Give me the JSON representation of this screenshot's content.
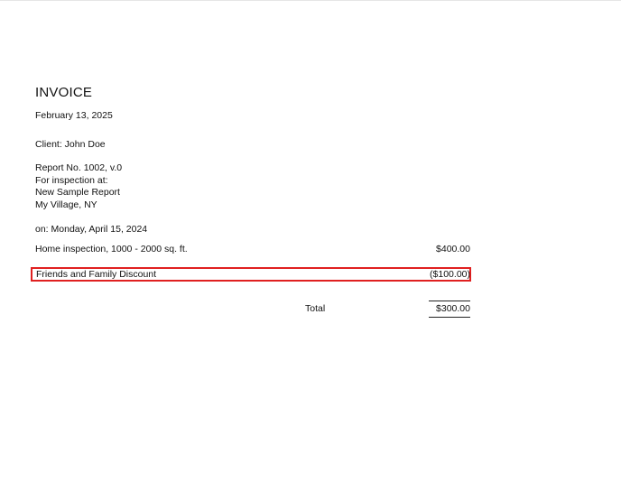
{
  "invoice": {
    "title": "INVOICE",
    "date": "February 13, 2025",
    "client": "Client: John Doe",
    "report_lines": [
      "Report No. 1002, v.0",
      "For inspection at:",
      "New Sample Report",
      "My Village, NY"
    ],
    "inspection_date": "on: Monday, April 15, 2024",
    "line_items": [
      {
        "description": "Home inspection, 1000 - 2000 sq. ft.",
        "amount": "$400.00"
      },
      {
        "description": "Friends and Family Discount",
        "amount": "($100.00)",
        "highlighted": true
      }
    ],
    "total_label": "Total",
    "total_amount": "$300.00"
  },
  "colors": {
    "highlight_border": "#e02020",
    "text": "#111111"
  }
}
